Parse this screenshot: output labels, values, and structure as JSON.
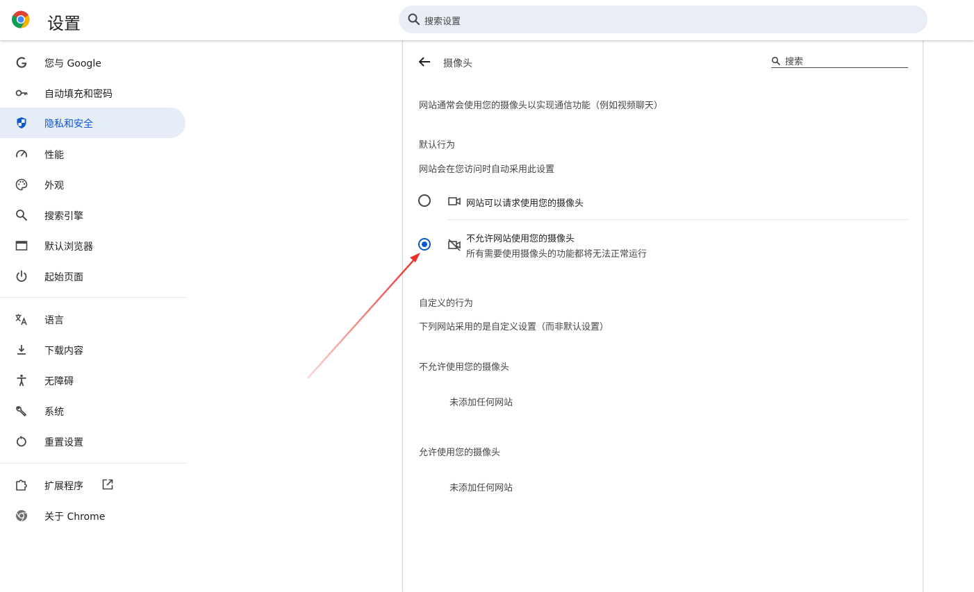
{
  "header": {
    "title": "设置",
    "search_placeholder": "搜索设置"
  },
  "sidebar": {
    "items": [
      {
        "label": "您与 Google",
        "icon": "google-g-icon"
      },
      {
        "label": "自动填充和密码",
        "icon": "key-icon"
      },
      {
        "label": "隐私和安全",
        "icon": "shield-icon",
        "active": true
      },
      {
        "label": "性能",
        "icon": "speedometer-icon"
      },
      {
        "label": "外观",
        "icon": "palette-icon"
      },
      {
        "label": "搜索引擎",
        "icon": "search-icon"
      },
      {
        "label": "默认浏览器",
        "icon": "browser-window-icon"
      },
      {
        "label": "起始页面",
        "icon": "power-icon"
      },
      {
        "label": "语言",
        "icon": "translate-icon"
      },
      {
        "label": "下载内容",
        "icon": "download-icon"
      },
      {
        "label": "无障碍",
        "icon": "accessibility-icon"
      },
      {
        "label": "系统",
        "icon": "wrench-icon"
      },
      {
        "label": "重置设置",
        "icon": "reset-icon"
      },
      {
        "label": "扩展程序",
        "icon": "puzzle-icon"
      },
      {
        "label": "关于 Chrome",
        "icon": "chrome-icon"
      }
    ]
  },
  "panel": {
    "title": "摄像头",
    "search_placeholder": "搜索",
    "description": "网站通常会使用您的摄像头以实现通信功能（例如视频聊天）",
    "default_behavior": {
      "heading": "默认行为",
      "subtext": "网站会在您访问时自动采用此设置",
      "options": [
        {
          "label": "网站可以请求使用您的摄像头",
          "sublabel": "",
          "selected": false,
          "icon": "camera-icon"
        },
        {
          "label": "不允许网站使用您的摄像头",
          "sublabel": "所有需要使用摄像头的功能都将无法正常运行",
          "selected": true,
          "icon": "camera-off-icon"
        }
      ]
    },
    "custom_behavior": {
      "heading": "自定义的行为",
      "subtext": "下列网站采用的是自定义设置（而非默认设置）",
      "blocked": {
        "heading": "不允许使用您的摄像头",
        "empty": "未添加任何网站"
      },
      "allowed": {
        "heading": "允许使用您的摄像头",
        "empty": "未添加任何网站"
      }
    }
  },
  "colors": {
    "accent": "#0b57d0",
    "active_bg": "#e6ecf8",
    "annotation_arrow": "#e8312a"
  }
}
